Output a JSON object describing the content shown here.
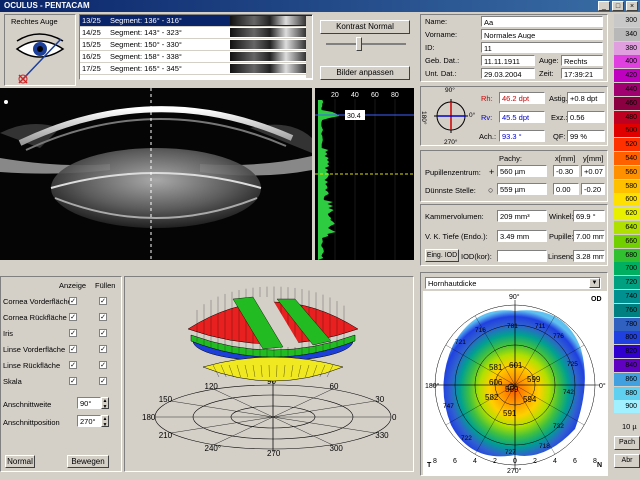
{
  "window": {
    "title": "OCULUS - PENTACAM"
  },
  "eye_selector": {
    "label": "Rechtes Auge"
  },
  "segments": [
    {
      "num": "13/25",
      "text": "Segment: 136° - 316°",
      "selected": true
    },
    {
      "num": "14/25",
      "text": "Segment: 143° - 323°",
      "selected": false
    },
    {
      "num": "15/25",
      "text": "Segment: 150° - 330°",
      "selected": false
    },
    {
      "num": "16/25",
      "text": "Segment: 158° - 338°",
      "selected": false
    },
    {
      "num": "17/25",
      "text": "Segment: 165° - 345°",
      "selected": false
    }
  ],
  "buttons": {
    "contrast": "Kontrast Normal",
    "adjust": "Bilder anpassen",
    "normal": "Normal",
    "move": "Bewegen",
    "eing_iod": "Eing. IOD",
    "iod_kor": "IOD(kor):"
  },
  "histogram": {
    "ticks": [
      "20",
      "40",
      "60",
      "80"
    ],
    "marker_value": "30.4"
  },
  "patient": {
    "name_label": "Name:",
    "name": "Aa",
    "vorname_label": "Vorname:",
    "vorname": "Normales Auge",
    "id_label": "ID:",
    "id": "11",
    "geb_label": "Geb. Dat.:",
    "geb": "11.11.1911",
    "auge_label": "Auge:",
    "auge": "Rechts",
    "unt_label": "Unt. Dat.:",
    "unt": "29.03.2004",
    "zeit_label": "Zeit:",
    "zeit": "17:39:21"
  },
  "keratometry": {
    "axis_top": "90°",
    "axis_bottom": "270°",
    "axis_left": "180°",
    "axis_right": "0°",
    "rh_label": "Rh:",
    "rh": "46.2 dpt",
    "rv_label": "Rv:",
    "rv": "45.5 dpt",
    "ach_label": "Ach.:",
    "ach": "93.3 °",
    "astig_label": "Astig.:",
    "astig": "+0.8 dpt",
    "exz_label": "Exz.:",
    "exz": "0.56",
    "qf_label": "QF:",
    "qf": "99 %"
  },
  "pachy": {
    "col_pachy": "Pachy:",
    "col_x": "x[mm]",
    "col_y": "y[mm]",
    "pupil_label": "Pupillenzentrum:",
    "pupil_val": "560 µm",
    "pupil_x": "-0.30",
    "pupil_y": "+0.07",
    "thin_label": "Dünnste Stelle:",
    "thin_val": "559 µm",
    "thin_x": "0.00",
    "thin_y": "-0.20"
  },
  "chamber": {
    "vol_label": "Kammervolumen:",
    "vol": "209 mm³",
    "winkel_label": "Winkel:",
    "winkel": "69.9 °",
    "tiefe_label": "V. K. Tiefe (Endo.):",
    "tiefe": "3.49 mm",
    "pupille_label": "Pupille:",
    "pupille": "7.00 mm",
    "linse_label": "Linsendi.:",
    "linse": "3.28 mm"
  },
  "layers": {
    "col_show": "Anzeige",
    "col_fill": "Füllen",
    "items": [
      "Cornea Vorderfläche",
      "Cornea Rückfläche",
      "Iris",
      "Linse Vorderfläche",
      "Linse Rückfläche",
      "Skala"
    ],
    "weite_label": "Anschnittweite",
    "weite": "90°",
    "position_label": "Anschnittposition",
    "position": "270°"
  },
  "model3d": {
    "angles": [
      "90",
      "120",
      "150",
      "180",
      "210",
      "240°",
      "270",
      "300",
      "330",
      "0",
      "30",
      "60"
    ]
  },
  "pachy_map": {
    "dropdown": "Hornhautdicke",
    "od": "OD",
    "angle_top": "90°",
    "angle_bottom": "270°",
    "angle_left": "180°",
    "angle_right": "0°",
    "corner_t": "T",
    "corner_n": "N",
    "x_ticks": [
      "8",
      "6",
      "4",
      "2",
      "0",
      "2",
      "4",
      "6",
      "8"
    ],
    "values": [
      "581",
      "606",
      "601",
      "599",
      "582",
      "559",
      "594",
      "591",
      "721",
      "781",
      "776",
      "747",
      "742",
      "732",
      "722",
      "727",
      "718",
      "716",
      "711",
      "725"
    ]
  },
  "color_scale": [
    "300",
    "340",
    "380",
    "400",
    "420",
    "440",
    "460",
    "480",
    "500",
    "520",
    "540",
    "560",
    "580",
    "600",
    "620",
    "640",
    "660",
    "680",
    "700",
    "720",
    "740",
    "760",
    "780",
    "800",
    "820",
    "840",
    "860",
    "880",
    "900"
  ],
  "colors": {
    "title_bar": "#0a246a",
    "selected": "#0a246a",
    "rh_color": "#cc0000",
    "rv_color": "#0000cc"
  },
  "footer": {
    "scale_step": "10 µ",
    "pach_btn": "Pach",
    "abr_btn": "Abr"
  }
}
